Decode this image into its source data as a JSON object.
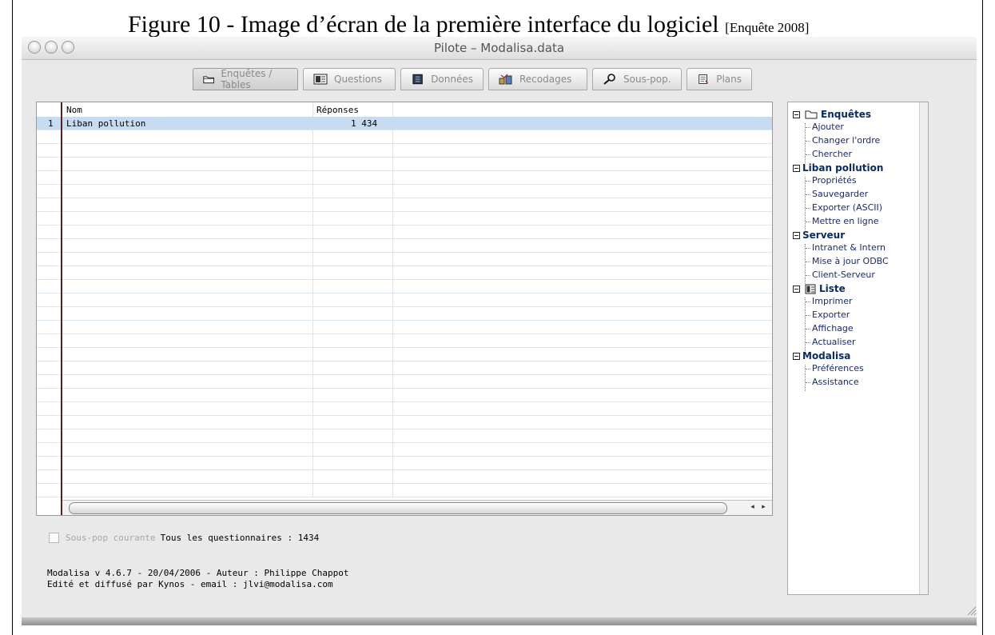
{
  "caption": {
    "text": "Figure 10 - Image d’écran de la première interface du logiciel",
    "source": "[Enquête 2008]"
  },
  "window": {
    "title": "Pilote – Modalisa.data"
  },
  "tabs": [
    {
      "label": "Enquêtes / Tables",
      "icon": "folder-icon"
    },
    {
      "label": "Questions",
      "icon": "list-icon"
    },
    {
      "label": "Données",
      "icon": "data-icon"
    },
    {
      "label": "Recodages",
      "icon": "recode-icon"
    },
    {
      "label": "Sous-pop.",
      "icon": "search-icon"
    },
    {
      "label": "Plans",
      "icon": "plan-icon"
    }
  ],
  "table": {
    "columns": [
      "Nom",
      "Réponses"
    ],
    "rows": [
      {
        "num": "1",
        "nom": "Liban pollution",
        "reponses": "1 434"
      }
    ]
  },
  "footer": {
    "checkbox_label": "Sous-pop courante",
    "all_label": "Tous les questionnaires : 1434",
    "version": "Modalisa v 4.6.7  -  20/04/2006  -  Auteur : Philippe Chappot",
    "publisher": "Edité et diffusé par Kynos  -  email : jlvi@modalisa.com"
  },
  "tree": {
    "enquetes": {
      "label": "Enquêtes",
      "items": [
        "Ajouter",
        "Changer l'ordre",
        "Chercher"
      ]
    },
    "liban": {
      "label": "Liban pollution",
      "items": [
        "Propriétés",
        "Sauvegarder",
        "Exporter (ASCII)",
        "Mettre en ligne"
      ]
    },
    "serveur": {
      "label": "Serveur",
      "items": [
        "Intranet & Intern",
        "Mise à jour ODBC",
        "Client-Serveur"
      ]
    },
    "liste": {
      "label": "Liste",
      "items": [
        "Imprimer",
        "Exporter",
        "Affichage",
        "Actualiser"
      ]
    },
    "modalisa": {
      "label": "Modalisa",
      "items": [
        "Préférences",
        "Assistance"
      ]
    }
  }
}
